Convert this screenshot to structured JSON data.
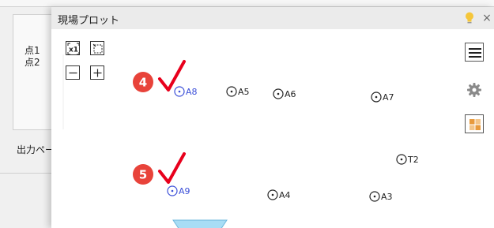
{
  "background_dialog": {
    "points": [
      "点1",
      "点2"
    ],
    "output_label": "出力ペー"
  },
  "plot_window": {
    "title": "現場プロット",
    "close_label": "×",
    "tools": {
      "zoom_extents_label": "x1"
    },
    "colors": {
      "accent_blue": "#3b4fd8",
      "point_black": "#222222",
      "badge_red": "#e8433a",
      "check_red": "#e8001c",
      "marker_cyan": "#a8ddf5",
      "bulb_yellow": "#f5c63a"
    },
    "callouts": [
      {
        "number": "4"
      },
      {
        "number": "5"
      }
    ],
    "points": [
      {
        "label": "A8",
        "highlighted": true
      },
      {
        "label": "A5",
        "highlighted": false
      },
      {
        "label": "A6",
        "highlighted": false
      },
      {
        "label": "A7",
        "highlighted": false
      },
      {
        "label": "T2",
        "highlighted": false
      },
      {
        "label": "A9",
        "highlighted": true
      },
      {
        "label": "A4",
        "highlighted": false
      },
      {
        "label": "A3",
        "highlighted": false
      }
    ],
    "icons": {
      "menu": "hamburger-menu-icon",
      "settings": "gear-icon",
      "layout": "grid-layout-icon",
      "bulb": "lightbulb-icon",
      "zoom_extents": "zoom-extents-icon",
      "zoom_window": "zoom-window-icon",
      "zoom_out": "zoom-out-icon",
      "zoom_in": "zoom-in-icon"
    }
  }
}
